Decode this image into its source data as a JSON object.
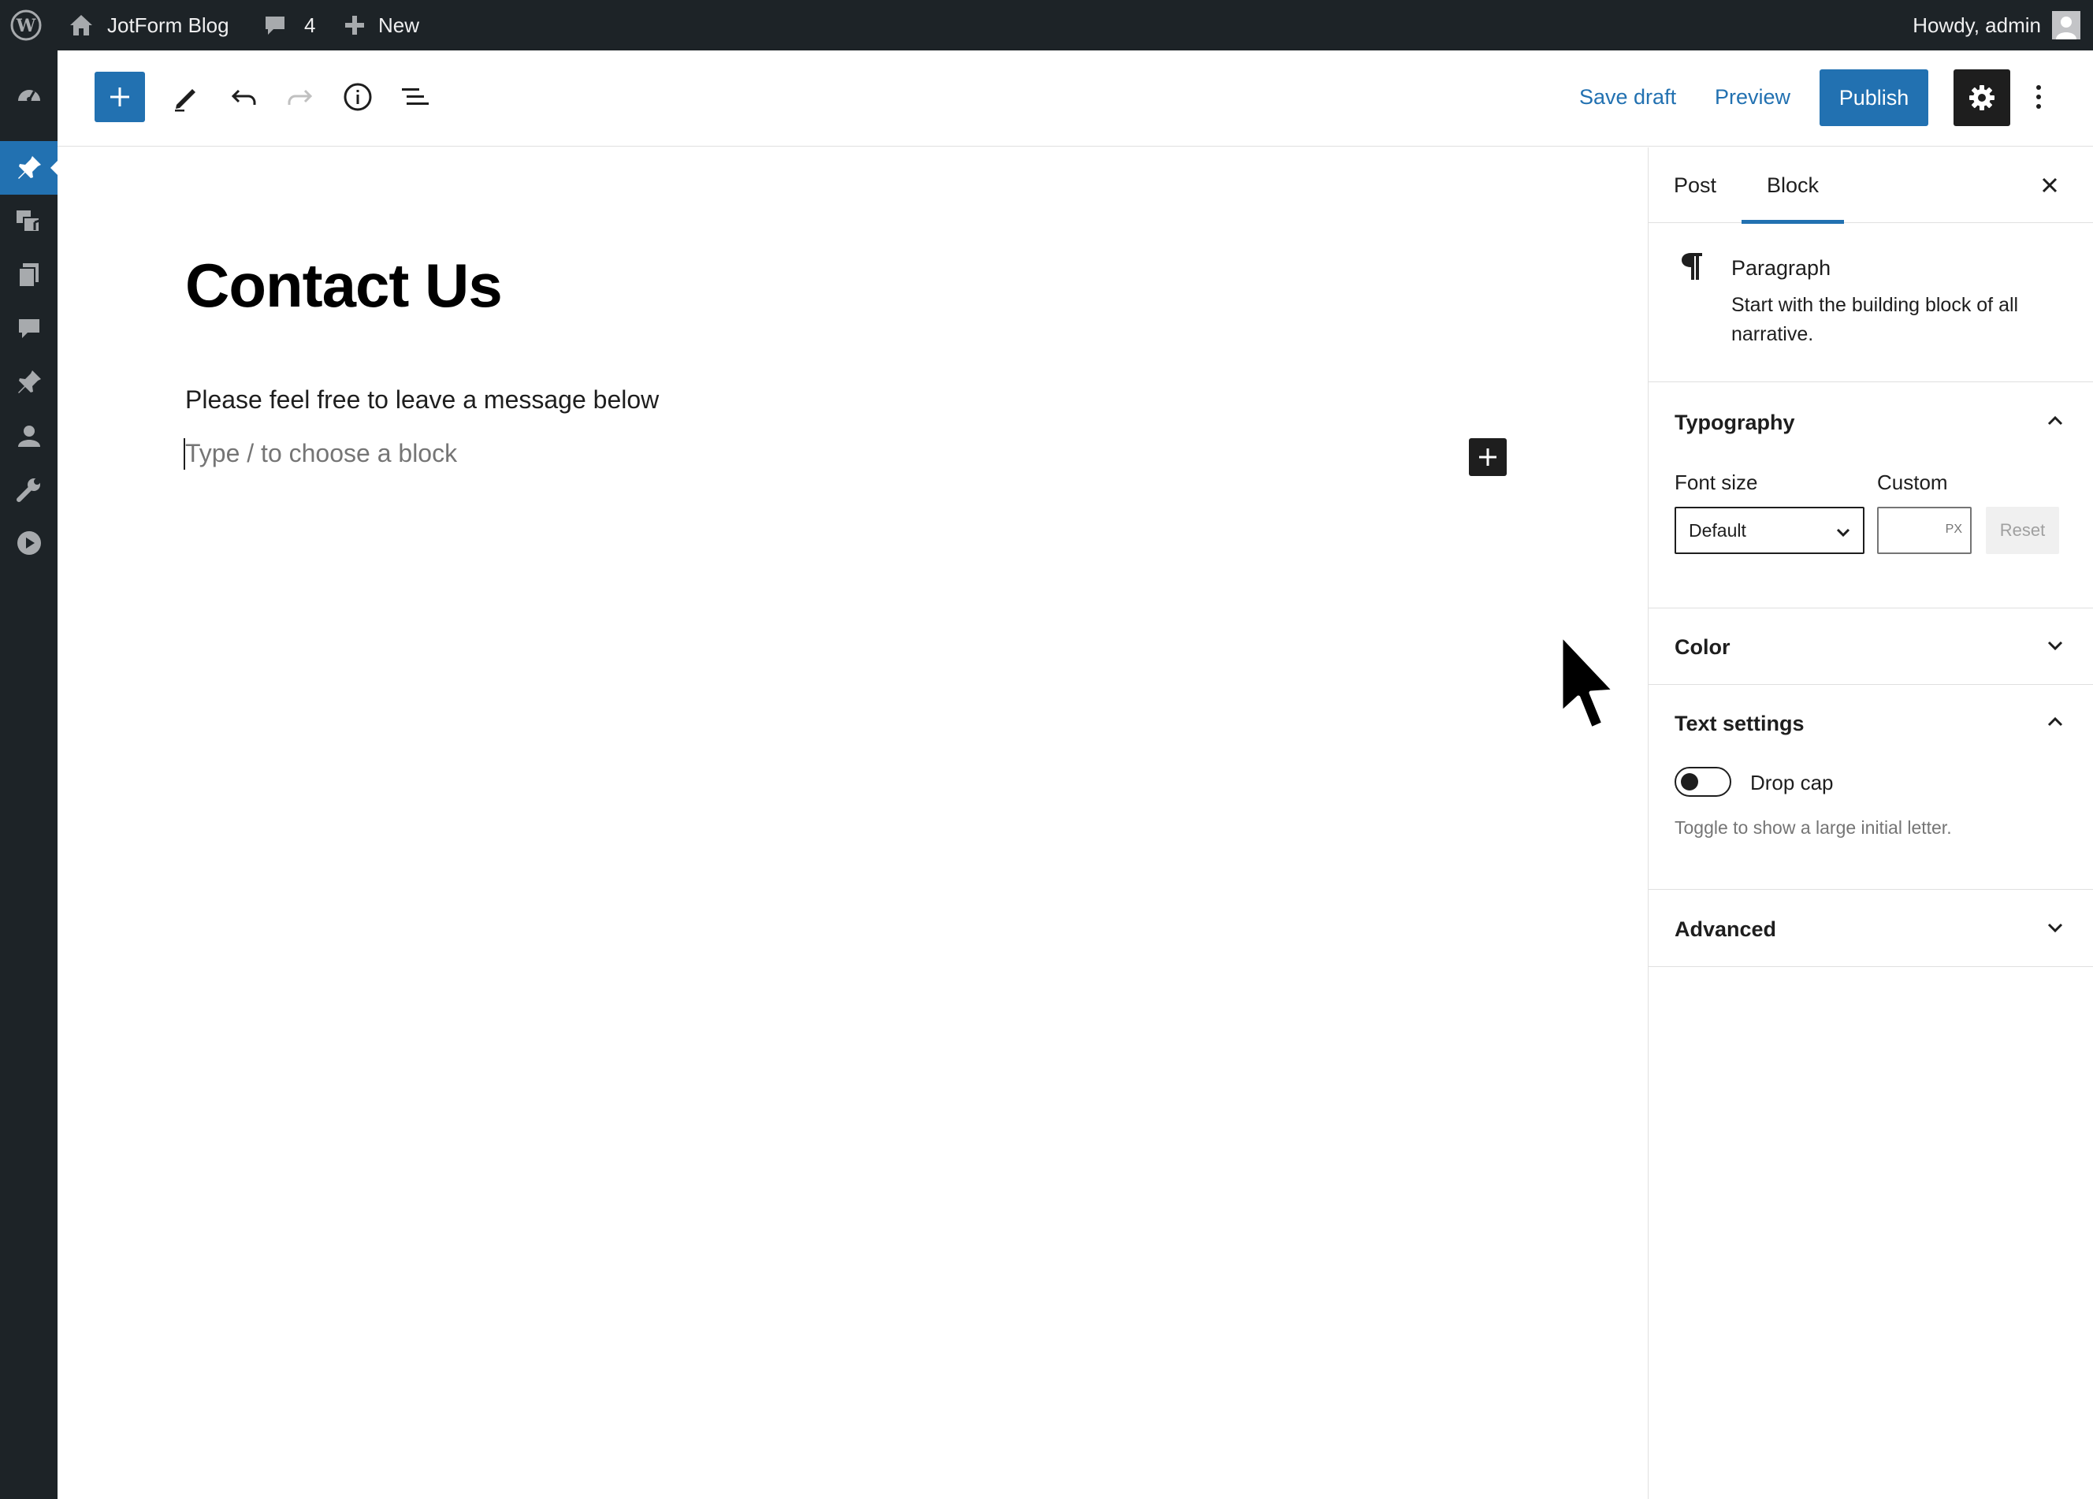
{
  "admin_bar": {
    "site_name": "JotForm Blog",
    "comment_count": "4",
    "new_label": "New",
    "greeting": "Howdy, admin",
    "icons": [
      "wordpress-logo-icon",
      "home-icon",
      "comment-bubble-icon",
      "plus-icon",
      "user-avatar-icon"
    ]
  },
  "admin_menu": {
    "icons": [
      "dashboard-icon",
      "posts-pin-icon",
      "media-icon",
      "pages-icon",
      "comments-icon",
      "pin-icon",
      "users-icon",
      "tools-icon",
      "play-icon"
    ],
    "active": "posts-pin-icon"
  },
  "toolbar": {
    "icons": [
      "block-inserter-plus-icon",
      "edit-pencil-icon",
      "undo-icon",
      "redo-icon",
      "details-info-icon",
      "list-view-icon"
    ],
    "save_draft_label": "Save draft",
    "preview_label": "Preview",
    "publish_label": "Publish",
    "settings_icon": "gear-icon",
    "options_icon": "more-vertical-icon"
  },
  "editor": {
    "title": "Contact Us",
    "paragraph": "Please feel free to leave a message below",
    "placeholder": "Type / to choose a block",
    "add_block_icon": "plus-icon"
  },
  "settings_sidebar": {
    "tabs": [
      {
        "label": "Post",
        "active": false
      },
      {
        "label": "Block",
        "active": true
      }
    ],
    "close_icon": "close-icon",
    "block": {
      "icon": "pilcrow-icon",
      "name": "Paragraph",
      "description": "Start with the building block of all narrative."
    },
    "typography": {
      "title": "Typography",
      "expanded": true,
      "font_size_label": "Font size",
      "custom_label": "Custom",
      "font_size_value": "Default",
      "custom_unit": "PX",
      "custom_value": "",
      "reset_label": "Reset"
    },
    "color": {
      "title": "Color",
      "expanded": false
    },
    "text_settings": {
      "title": "Text settings",
      "expanded": true,
      "drop_cap_label": "Drop cap",
      "drop_cap_on": false,
      "help": "Toggle to show a large initial letter."
    },
    "advanced": {
      "title": "Advanced",
      "expanded": false
    }
  },
  "colors": {
    "admin_bar_bg": "#1d2327",
    "accent": "#2271b1",
    "text": "#1e1e1e",
    "muted": "#757575"
  }
}
